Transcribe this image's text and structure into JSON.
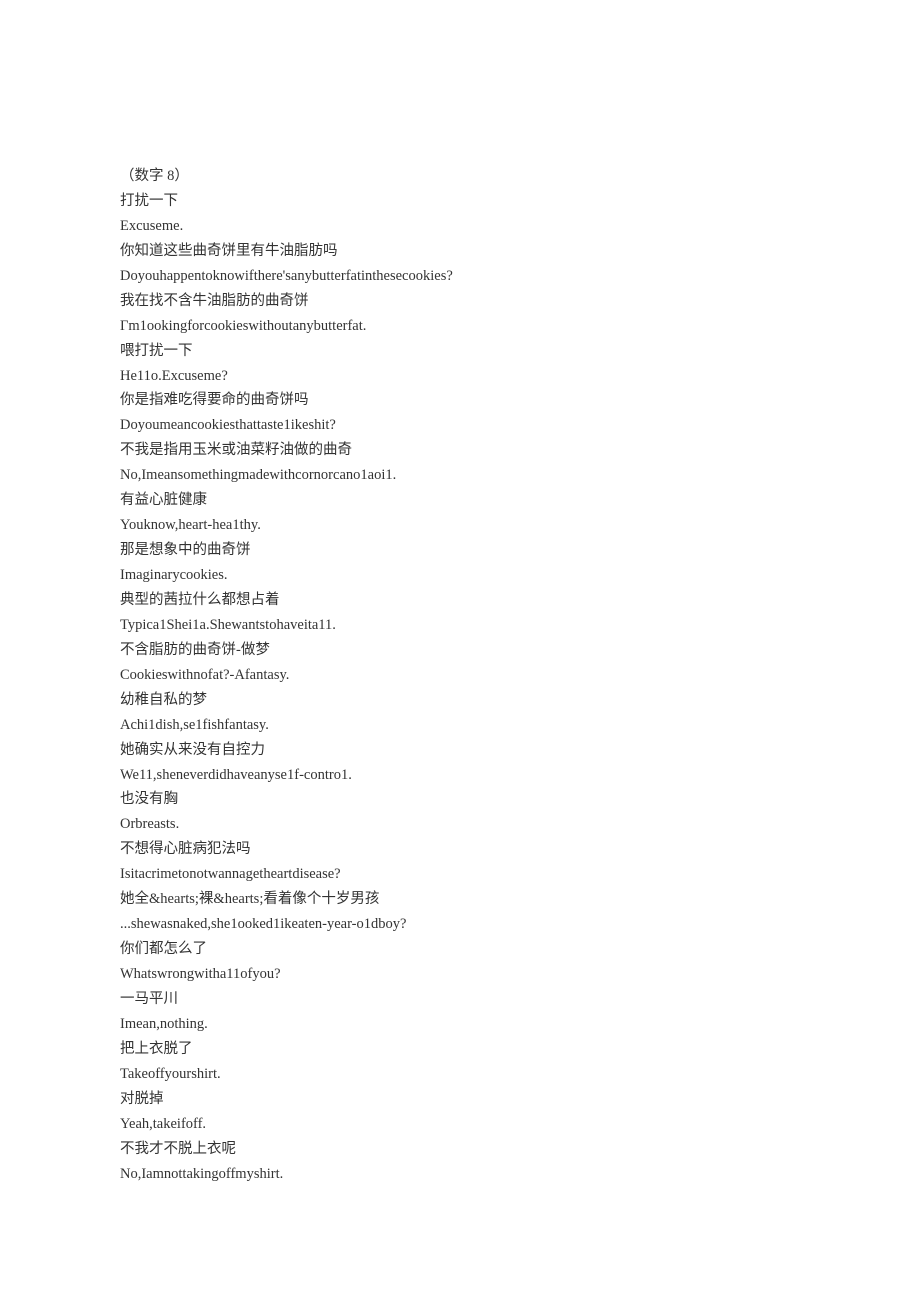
{
  "lines": [
    "（数字 8）",
    "打扰一下",
    "Excuseme.",
    "你知道这些曲奇饼里有牛油脂肪吗",
    "Doyouhappentoknowifthere'sanybutterfatinthesecookies?",
    "我在找不含牛油脂肪的曲奇饼",
    "Γm1ookingforcookieswithoutanybutterfat.",
    "喂打扰一下",
    "He11o.Excuseme?",
    "你是指难吃得要命的曲奇饼吗",
    "Doyoumeancookiesthattaste1ikeshit?",
    "不我是指用玉米或油菜籽油做的曲奇",
    "No,Imeansomethingmadewithcornorcano1aoi1.",
    "有益心脏健康",
    "Youknow,heart-hea1thy.",
    "那是想象中的曲奇饼",
    "Imaginarycookies.",
    "典型的茜拉什么都想占着",
    "Typica1Shei1a.Shewantstohaveita11.",
    "不含脂肪的曲奇饼-做梦",
    "Cookieswithnofat?-Afantasy.",
    "幼稚自私的梦",
    "Achi1dish,se1fishfantasy.",
    "她确实从来没有自控力",
    "We11,sheneverdidhaveanyse1f-contro1.",
    "也没有胸",
    "Orbreasts.",
    "不想得心脏病犯法吗",
    "Isitacrimetonotwannagetheartdisease?",
    "她全&hearts;裸&hearts;看着像个十岁男孩",
    "...shewasnaked,she1ooked1ikeaten-year-o1dboy?",
    "你们都怎么了",
    "Whatswrongwitha11ofyou?",
    "一马平川",
    "Imean,nothing.",
    "把上衣脱了",
    "Takeoffyourshirt.",
    "对脱掉",
    "Yeah,takeifoff.",
    "不我才不脱上衣呢",
    "No,Iamnottakingoffmyshirt."
  ]
}
